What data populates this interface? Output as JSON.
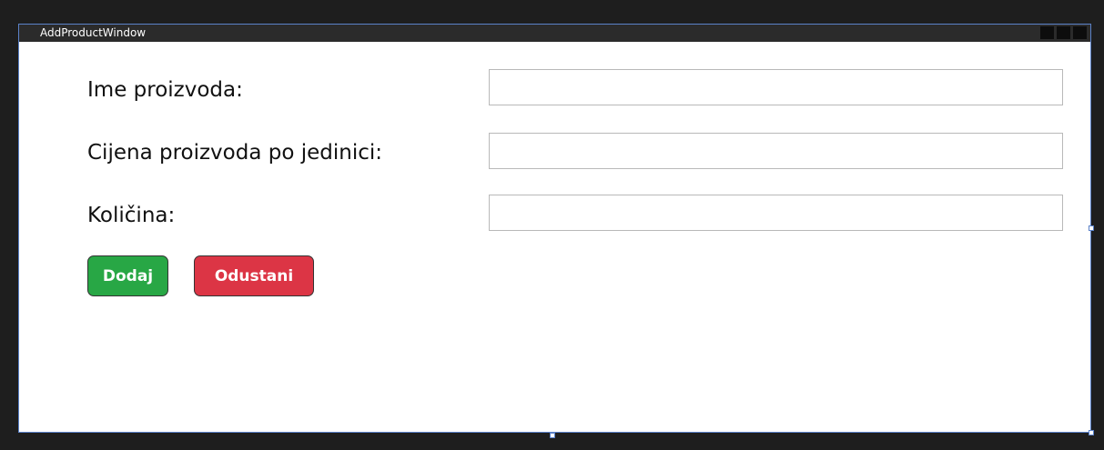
{
  "window": {
    "title": "AddProductWindow",
    "controls": [
      "minimize",
      "maximize",
      "close"
    ]
  },
  "form": {
    "product_name_label": "Ime proizvoda:",
    "product_name_value": "",
    "unit_price_label": "Cijena proizvoda po jedinici:",
    "unit_price_value": "",
    "quantity_label": "Količina:",
    "quantity_value": ""
  },
  "buttons": {
    "add_label": "Dodaj",
    "cancel_label": "Odustani"
  },
  "colors": {
    "add_button": "#28a745",
    "cancel_button": "#dc3545",
    "titlebar": "#2b2b2b",
    "window_border": "#5b82c9"
  }
}
